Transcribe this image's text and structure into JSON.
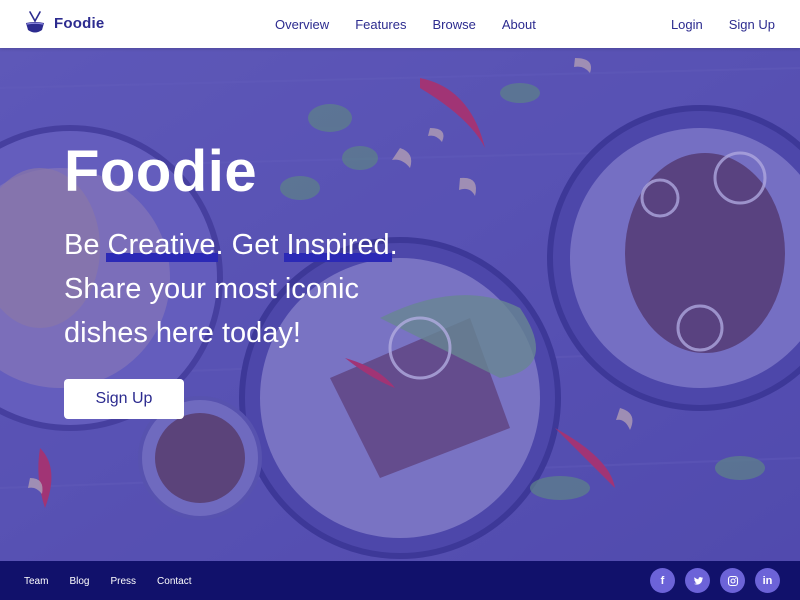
{
  "brand": {
    "name": "Foodie",
    "icon": "food-bowl-icon",
    "color": "#2c2b8f"
  },
  "nav": {
    "links": [
      {
        "label": "Overview"
      },
      {
        "label": "Features"
      },
      {
        "label": "Browse"
      },
      {
        "label": "About"
      }
    ],
    "login_label": "Login",
    "signup_label": "Sign Up"
  },
  "hero": {
    "title": "Foodie",
    "tagline": {
      "be": "Be ",
      "creative": "Creative",
      "get": ". Get ",
      "inspired": "Inspired",
      "end": ".",
      "line2": "Share your most iconic",
      "line3": "dishes here today!"
    },
    "cta_label": "Sign Up",
    "overlay_color": "#5850be",
    "highlight_color": "#2b29b6"
  },
  "footer": {
    "links": [
      {
        "label": "Team"
      },
      {
        "label": "Blog"
      },
      {
        "label": "Press"
      },
      {
        "label": "Contact"
      }
    ],
    "social": [
      {
        "name": "facebook-icon",
        "glyph": "f"
      },
      {
        "name": "twitter-icon",
        "glyph": ""
      },
      {
        "name": "instagram-icon",
        "glyph": ""
      },
      {
        "name": "linkedin-icon",
        "glyph": "in"
      }
    ],
    "background": "#11116b"
  }
}
